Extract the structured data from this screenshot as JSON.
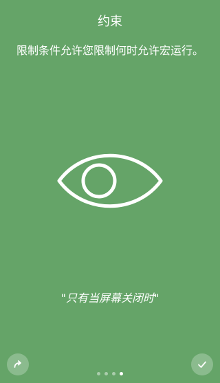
{
  "title": "约束",
  "description": "限制条件允许您限制何时允许宏运行。",
  "illustration": {
    "icon": "eye-icon"
  },
  "quote": "\"只有当屏幕关闭时\"",
  "navigation": {
    "skip_icon": "redo-icon",
    "done_icon": "check-icon",
    "page_count": 4,
    "active_page": 4
  },
  "colors": {
    "background": "#65a468",
    "foreground": "#ffffff"
  }
}
